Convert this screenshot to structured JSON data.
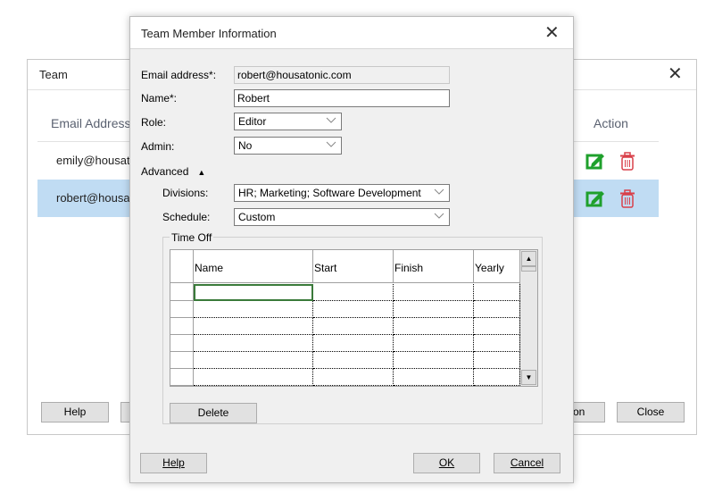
{
  "team_window": {
    "title": "Team",
    "columns": {
      "email": "Email Address",
      "action": "Action"
    },
    "rows": [
      {
        "email": "emily@housat",
        "selected": false
      },
      {
        "email": "robert@housa",
        "selected": true
      }
    ],
    "buttons": {
      "help": "Help",
      "partial": "on",
      "close": "Close"
    },
    "colors": {
      "selection": "#c0dcf3",
      "edit": "#1fa02c",
      "delete": "#d9404a"
    }
  },
  "dialog": {
    "title": "Team Member Information",
    "email_label": "Email address*:",
    "email_value": "robert@housatonic.com",
    "name_label": "Name*:",
    "name_value": "Robert",
    "role_label": "Role:",
    "role_value": "Editor",
    "admin_label": "Admin:",
    "admin_value": "No",
    "advanced_label": "Advanced",
    "advanced_icon": "triangle-up",
    "divisions_label": "Divisions:",
    "divisions_value": "HR; Marketing; Software Development",
    "schedule_label": "Schedule:",
    "schedule_value": "Custom",
    "timeoff": {
      "title": "Time Off",
      "columns": [
        "Name",
        "Start",
        "Finish",
        "Yearly"
      ],
      "delete": "Delete"
    },
    "buttons": {
      "help": "Help",
      "ok": "OK",
      "cancel": "Cancel"
    }
  }
}
